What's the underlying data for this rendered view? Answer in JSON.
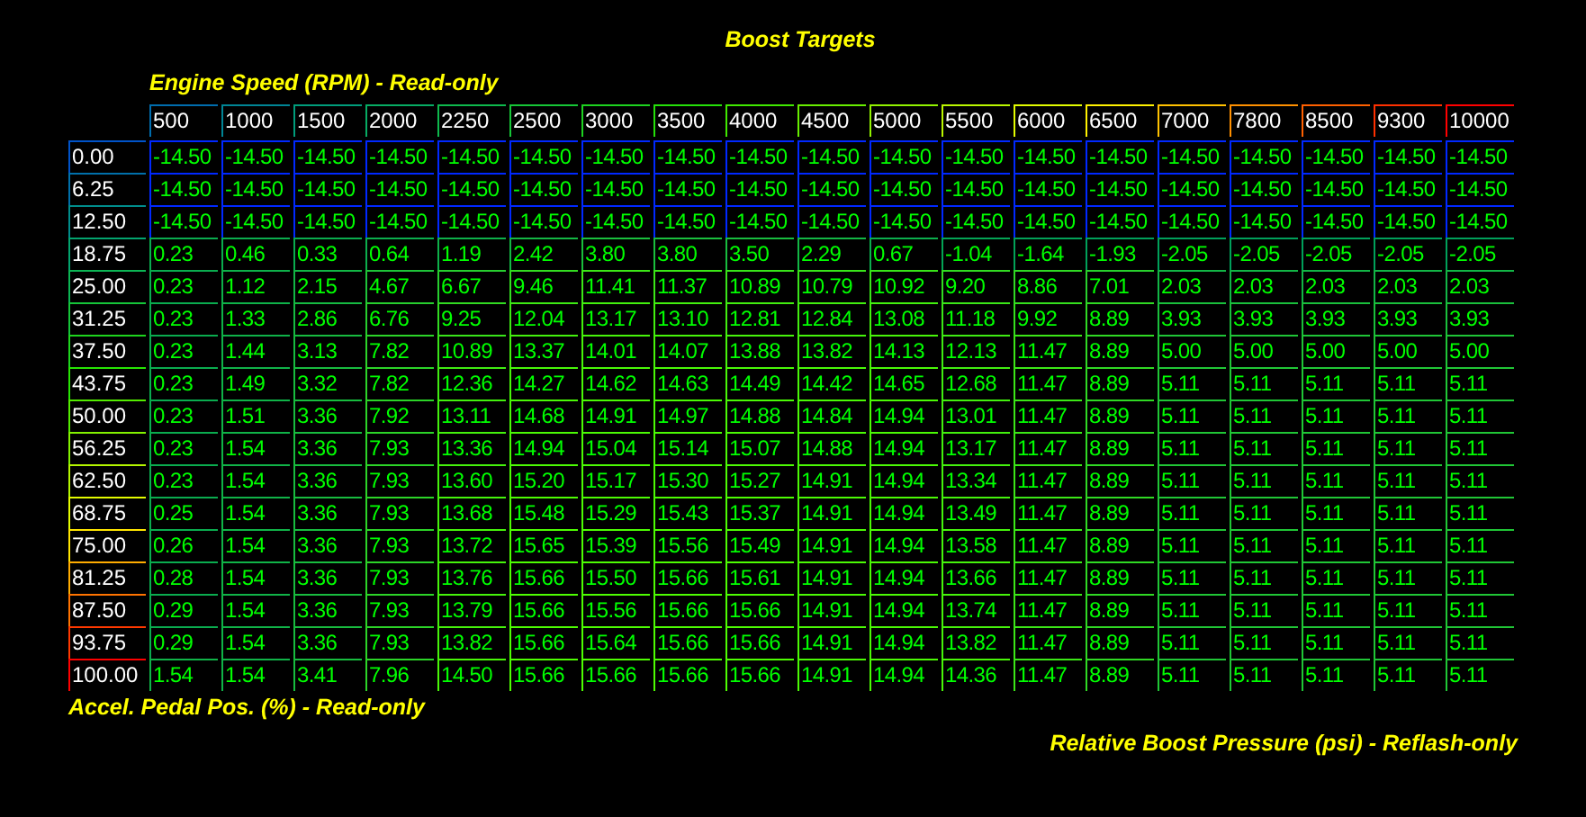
{
  "title": "Boost Targets",
  "x_axis_label": "Engine Speed (RPM) - Read-only",
  "columns": [
    "500",
    "1000",
    "1500",
    "2000",
    "2250",
    "2500",
    "3000",
    "3500",
    "4000",
    "4500",
    "5000",
    "5500",
    "6000",
    "6500",
    "7000",
    "7800",
    "8500",
    "9300",
    "10000"
  ],
  "rows": [
    {
      "label": "0.00",
      "values": [
        "-14.50",
        "-14.50",
        "-14.50",
        "-14.50",
        "-14.50",
        "-14.50",
        "-14.50",
        "-14.50",
        "-14.50",
        "-14.50",
        "-14.50",
        "-14.50",
        "-14.50",
        "-14.50",
        "-14.50",
        "-14.50",
        "-14.50",
        "-14.50",
        "-14.50"
      ]
    },
    {
      "label": "6.25",
      "values": [
        "-14.50",
        "-14.50",
        "-14.50",
        "-14.50",
        "-14.50",
        "-14.50",
        "-14.50",
        "-14.50",
        "-14.50",
        "-14.50",
        "-14.50",
        "-14.50",
        "-14.50",
        "-14.50",
        "-14.50",
        "-14.50",
        "-14.50",
        "-14.50",
        "-14.50"
      ]
    },
    {
      "label": "12.50",
      "values": [
        "-14.50",
        "-14.50",
        "-14.50",
        "-14.50",
        "-14.50",
        "-14.50",
        "-14.50",
        "-14.50",
        "-14.50",
        "-14.50",
        "-14.50",
        "-14.50",
        "-14.50",
        "-14.50",
        "-14.50",
        "-14.50",
        "-14.50",
        "-14.50",
        "-14.50"
      ]
    },
    {
      "label": "18.75",
      "values": [
        "0.23",
        "0.46",
        "0.33",
        "0.64",
        "1.19",
        "2.42",
        "3.80",
        "3.80",
        "3.50",
        "2.29",
        "0.67",
        "-1.04",
        "-1.64",
        "-1.93",
        "-2.05",
        "-2.05",
        "-2.05",
        "-2.05",
        "-2.05"
      ]
    },
    {
      "label": "25.00",
      "values": [
        "0.23",
        "1.12",
        "2.15",
        "4.67",
        "6.67",
        "9.46",
        "11.41",
        "11.37",
        "10.89",
        "10.79",
        "10.92",
        "9.20",
        "8.86",
        "7.01",
        "2.03",
        "2.03",
        "2.03",
        "2.03",
        "2.03"
      ]
    },
    {
      "label": "31.25",
      "values": [
        "0.23",
        "1.33",
        "2.86",
        "6.76",
        "9.25",
        "12.04",
        "13.17",
        "13.10",
        "12.81",
        "12.84",
        "13.08",
        "11.18",
        "9.92",
        "8.89",
        "3.93",
        "3.93",
        "3.93",
        "3.93",
        "3.93"
      ]
    },
    {
      "label": "37.50",
      "values": [
        "0.23",
        "1.44",
        "3.13",
        "7.82",
        "10.89",
        "13.37",
        "14.01",
        "14.07",
        "13.88",
        "13.82",
        "14.13",
        "12.13",
        "11.47",
        "8.89",
        "5.00",
        "5.00",
        "5.00",
        "5.00",
        "5.00"
      ]
    },
    {
      "label": "43.75",
      "values": [
        "0.23",
        "1.49",
        "3.32",
        "7.82",
        "12.36",
        "14.27",
        "14.62",
        "14.63",
        "14.49",
        "14.42",
        "14.65",
        "12.68",
        "11.47",
        "8.89",
        "5.11",
        "5.11",
        "5.11",
        "5.11",
        "5.11"
      ]
    },
    {
      "label": "50.00",
      "values": [
        "0.23",
        "1.51",
        "3.36",
        "7.92",
        "13.11",
        "14.68",
        "14.91",
        "14.97",
        "14.88",
        "14.84",
        "14.94",
        "13.01",
        "11.47",
        "8.89",
        "5.11",
        "5.11",
        "5.11",
        "5.11",
        "5.11"
      ]
    },
    {
      "label": "56.25",
      "values": [
        "0.23",
        "1.54",
        "3.36",
        "7.93",
        "13.36",
        "14.94",
        "15.04",
        "15.14",
        "15.07",
        "14.88",
        "14.94",
        "13.17",
        "11.47",
        "8.89",
        "5.11",
        "5.11",
        "5.11",
        "5.11",
        "5.11"
      ]
    },
    {
      "label": "62.50",
      "values": [
        "0.23",
        "1.54",
        "3.36",
        "7.93",
        "13.60",
        "15.20",
        "15.17",
        "15.30",
        "15.27",
        "14.91",
        "14.94",
        "13.34",
        "11.47",
        "8.89",
        "5.11",
        "5.11",
        "5.11",
        "5.11",
        "5.11"
      ]
    },
    {
      "label": "68.75",
      "values": [
        "0.25",
        "1.54",
        "3.36",
        "7.93",
        "13.68",
        "15.48",
        "15.29",
        "15.43",
        "15.37",
        "14.91",
        "14.94",
        "13.49",
        "11.47",
        "8.89",
        "5.11",
        "5.11",
        "5.11",
        "5.11",
        "5.11"
      ]
    },
    {
      "label": "75.00",
      "values": [
        "0.26",
        "1.54",
        "3.36",
        "7.93",
        "13.72",
        "15.65",
        "15.39",
        "15.56",
        "15.49",
        "14.91",
        "14.94",
        "13.58",
        "11.47",
        "8.89",
        "5.11",
        "5.11",
        "5.11",
        "5.11",
        "5.11"
      ]
    },
    {
      "label": "81.25",
      "values": [
        "0.28",
        "1.54",
        "3.36",
        "7.93",
        "13.76",
        "15.66",
        "15.50",
        "15.66",
        "15.61",
        "14.91",
        "14.94",
        "13.66",
        "11.47",
        "8.89",
        "5.11",
        "5.11",
        "5.11",
        "5.11",
        "5.11"
      ]
    },
    {
      "label": "87.50",
      "values": [
        "0.29",
        "1.54",
        "3.36",
        "7.93",
        "13.79",
        "15.66",
        "15.56",
        "15.66",
        "15.66",
        "14.91",
        "14.94",
        "13.74",
        "11.47",
        "8.89",
        "5.11",
        "5.11",
        "5.11",
        "5.11",
        "5.11"
      ]
    },
    {
      "label": "93.75",
      "values": [
        "0.29",
        "1.54",
        "3.36",
        "7.93",
        "13.82",
        "15.66",
        "15.64",
        "15.66",
        "15.66",
        "14.91",
        "14.94",
        "13.82",
        "11.47",
        "8.89",
        "5.11",
        "5.11",
        "5.11",
        "5.11",
        "5.11"
      ]
    },
    {
      "label": "100.00",
      "values": [
        "1.54",
        "1.54",
        "3.41",
        "7.96",
        "14.50",
        "15.66",
        "15.66",
        "15.66",
        "15.66",
        "14.91",
        "14.94",
        "14.36",
        "11.47",
        "8.89",
        "5.11",
        "5.11",
        "5.11",
        "5.11",
        "5.11"
      ]
    }
  ],
  "y_axis_label": "Accel. Pedal Pos. (%) - Read-only",
  "value_label": "Relative Boost Pressure (psi) - Reflash-only"
}
